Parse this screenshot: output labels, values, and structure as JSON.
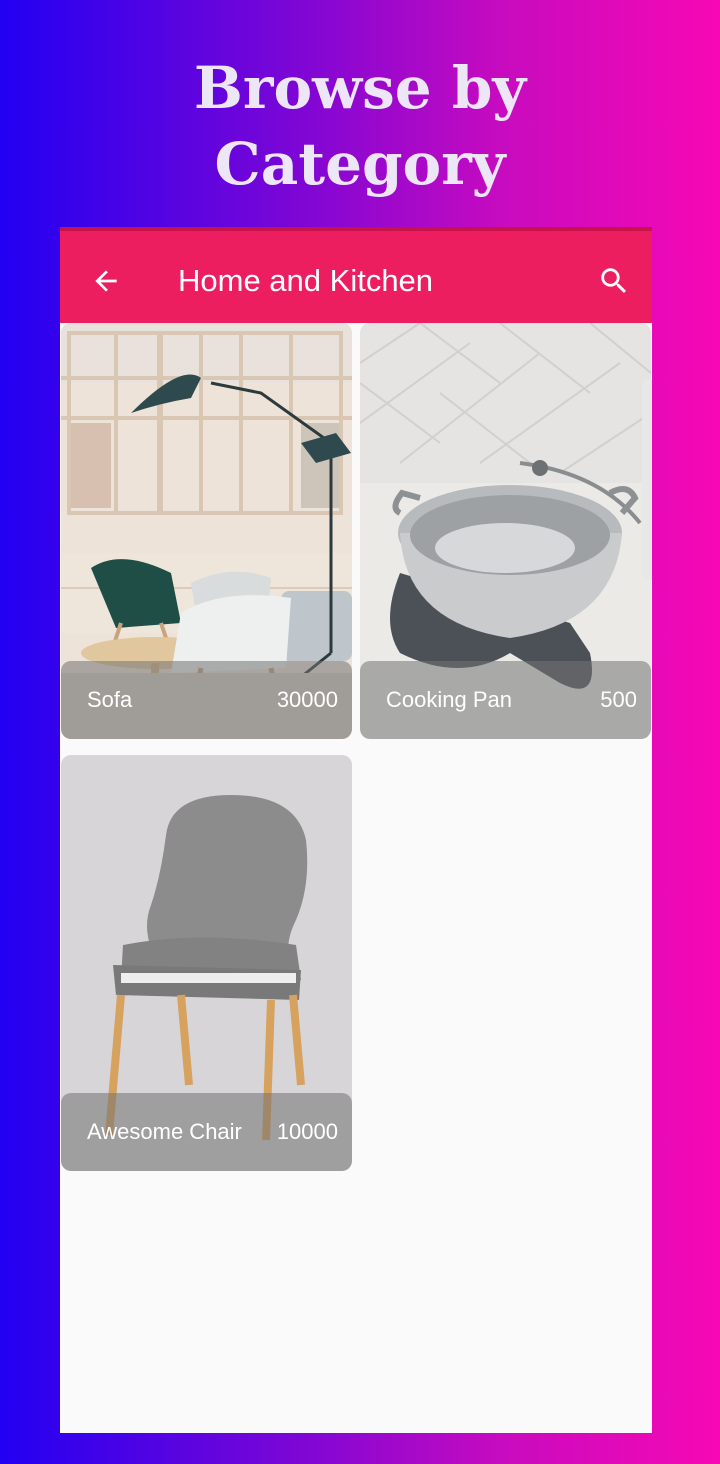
{
  "promo": {
    "title_line1": "Browse by",
    "title_line2": "Category"
  },
  "app_bar": {
    "back_icon": "arrow-left-icon",
    "title": "Home and Kitchen",
    "search_icon": "search-icon"
  },
  "products": [
    {
      "name": "Sofa",
      "price": "30000",
      "image": "living-room-chairs-lamp"
    },
    {
      "name": "Cooking Pan",
      "price": "500",
      "image": "stainless-pan"
    },
    {
      "name": "Awesome Chair",
      "price": "10000",
      "image": "grey-chair"
    }
  ],
  "colors": {
    "app_bar": "#ec1e5f",
    "background_gradient_start": "#2200f2",
    "background_gradient_end": "#f708b4"
  }
}
